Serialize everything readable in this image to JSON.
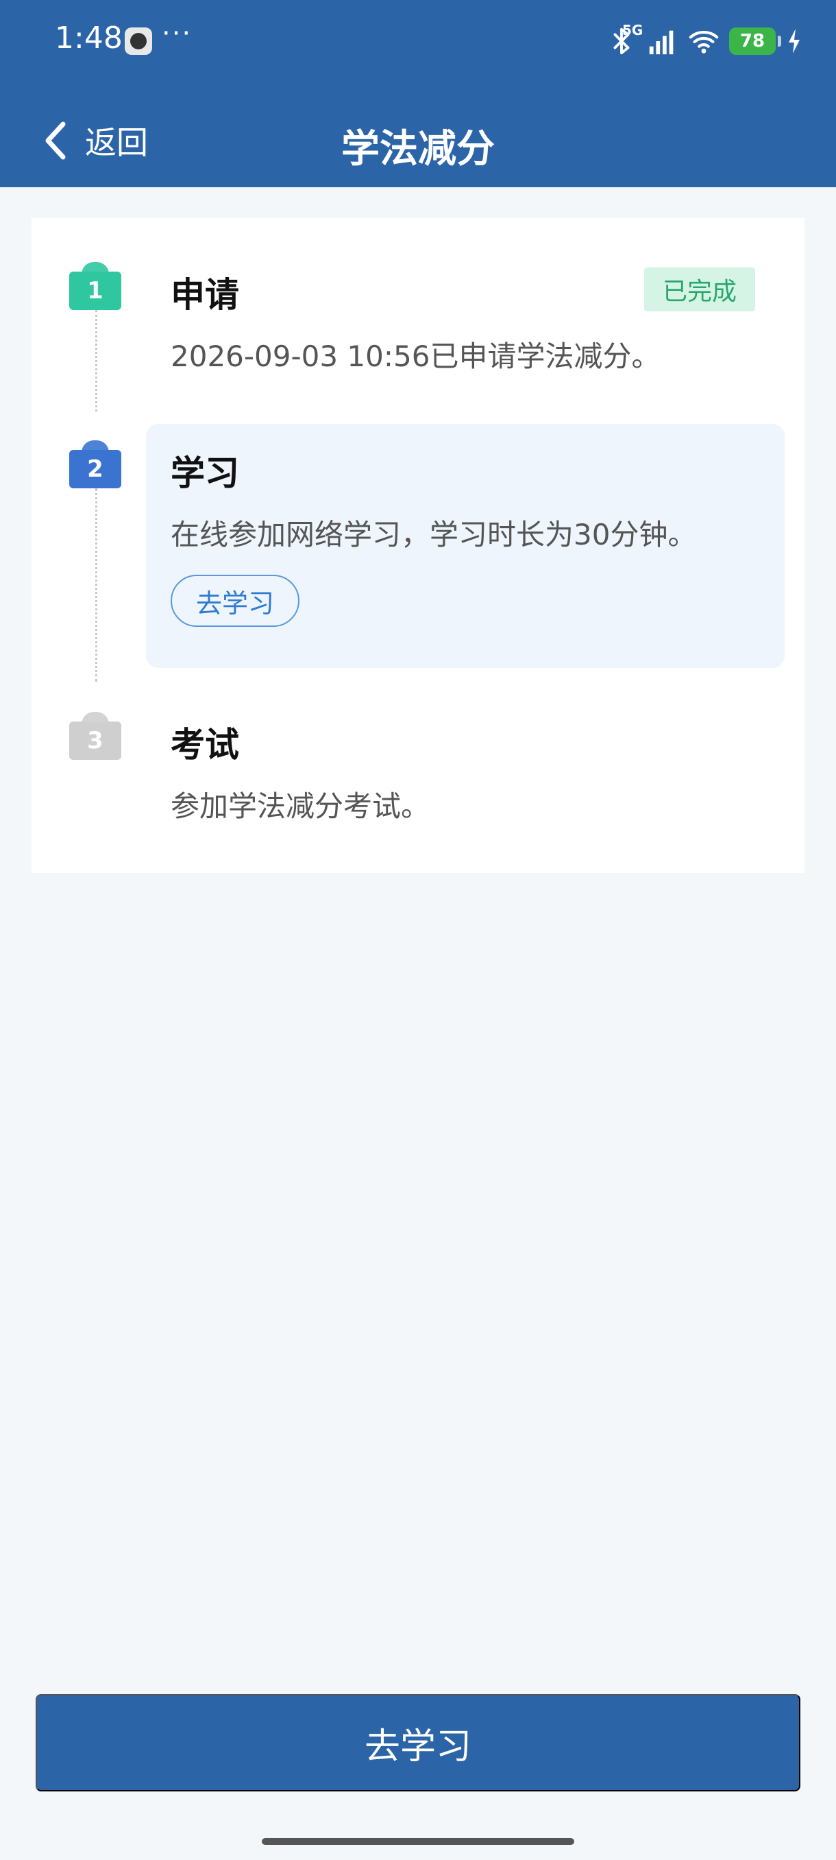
{
  "status_bar": {
    "time": "1:48",
    "more": "···",
    "network": "5G",
    "battery": "78",
    "icons": [
      "app-icon",
      "bluetooth-icon",
      "signal-icon",
      "wifi-icon",
      "battery-icon",
      "charging-icon"
    ]
  },
  "nav": {
    "back_label": "返回",
    "title": "学法减分"
  },
  "steps": [
    {
      "number": "1",
      "title": "申请",
      "status": "已完成",
      "description": "2026-09-03 10:56已申请学法减分。"
    },
    {
      "number": "2",
      "title": "学习",
      "description": "在线参加网络学习，学习时长为30分钟。",
      "action": "去学习"
    },
    {
      "number": "3",
      "title": "考试",
      "description": "参加学法减分考试。"
    }
  ],
  "footer": {
    "primary_button": "去学习"
  },
  "colors": {
    "brand_blue": "#2c64a8",
    "step_done": "#2ec7a0",
    "step_current": "#3a74d0",
    "step_pending": "#cfcfcf",
    "done_badge_bg": "#d6f4e5",
    "done_badge_text": "#27a86a"
  }
}
